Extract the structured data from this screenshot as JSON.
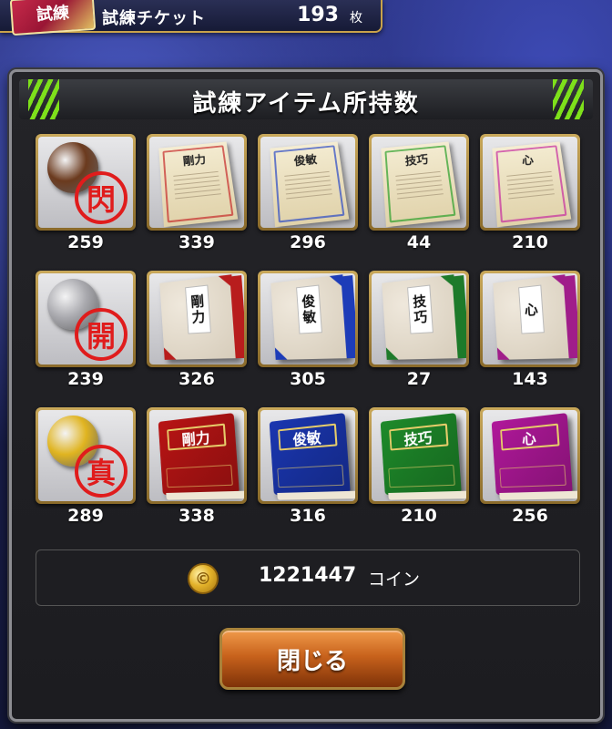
{
  "ticket_bar": {
    "icon_label": "試練",
    "label": "試練チケット",
    "count": "193",
    "unit": "枚"
  },
  "dialog": {
    "title": "試練アイテム所持数",
    "accent_color": "#7ee01b",
    "items": [
      {
        "kind": "stamp",
        "icon": "bronze-stamp-icon",
        "glyph": "閃",
        "knob_color": "#6b3a1e",
        "count": "259"
      },
      {
        "kind": "doc",
        "icon": "strength-scroll-icon",
        "title": "剛力",
        "color": "#c62a2a",
        "count": "339"
      },
      {
        "kind": "doc",
        "icon": "agility-scroll-icon",
        "title": "俊敏",
        "color": "#2a48c6",
        "count": "296"
      },
      {
        "kind": "doc",
        "icon": "technique-scroll-icon",
        "title": "技巧",
        "color": "#2aa02a",
        "count": "44"
      },
      {
        "kind": "doc",
        "icon": "heart-scroll-icon",
        "title": "心",
        "color": "#c62aa0",
        "count": "210"
      },
      {
        "kind": "stamp",
        "icon": "silver-stamp-icon",
        "glyph": "開",
        "knob_color": "#a9a9ae",
        "count": "239"
      },
      {
        "kind": "jbook",
        "icon": "strength-bound-book-icon",
        "title": "剛力",
        "color": "#b81d1d",
        "count": "326"
      },
      {
        "kind": "jbook",
        "icon": "agility-bound-book-icon",
        "title": "俊敏",
        "color": "#1d3cb8",
        "count": "305"
      },
      {
        "kind": "jbook",
        "icon": "technique-bound-book-icon",
        "title": "技巧",
        "color": "#1d7a2a",
        "count": "27"
      },
      {
        "kind": "jbook",
        "icon": "heart-bound-book-icon",
        "title": "心",
        "color": "#a01d8a",
        "count": "143"
      },
      {
        "kind": "stamp",
        "icon": "gold-stamp-icon",
        "glyph": "真",
        "knob_color": "#e0b420",
        "count": "289"
      },
      {
        "kind": "hbook",
        "icon": "strength-hardcover-book-icon",
        "title": "剛力",
        "color": "#b81414",
        "count": "338"
      },
      {
        "kind": "hbook",
        "icon": "agility-hardcover-book-icon",
        "title": "俊敏",
        "color": "#1a36b0",
        "count": "316"
      },
      {
        "kind": "hbook",
        "icon": "technique-hardcover-book-icon",
        "title": "技巧",
        "color": "#1e8a2a",
        "count": "210"
      },
      {
        "kind": "hbook",
        "icon": "heart-hardcover-book-icon",
        "title": "心",
        "color": "#b0189a",
        "count": "256"
      }
    ],
    "coins": {
      "icon_glyph": "©",
      "amount": "1221447",
      "unit": "コイン"
    },
    "close_label": "閉じる"
  }
}
